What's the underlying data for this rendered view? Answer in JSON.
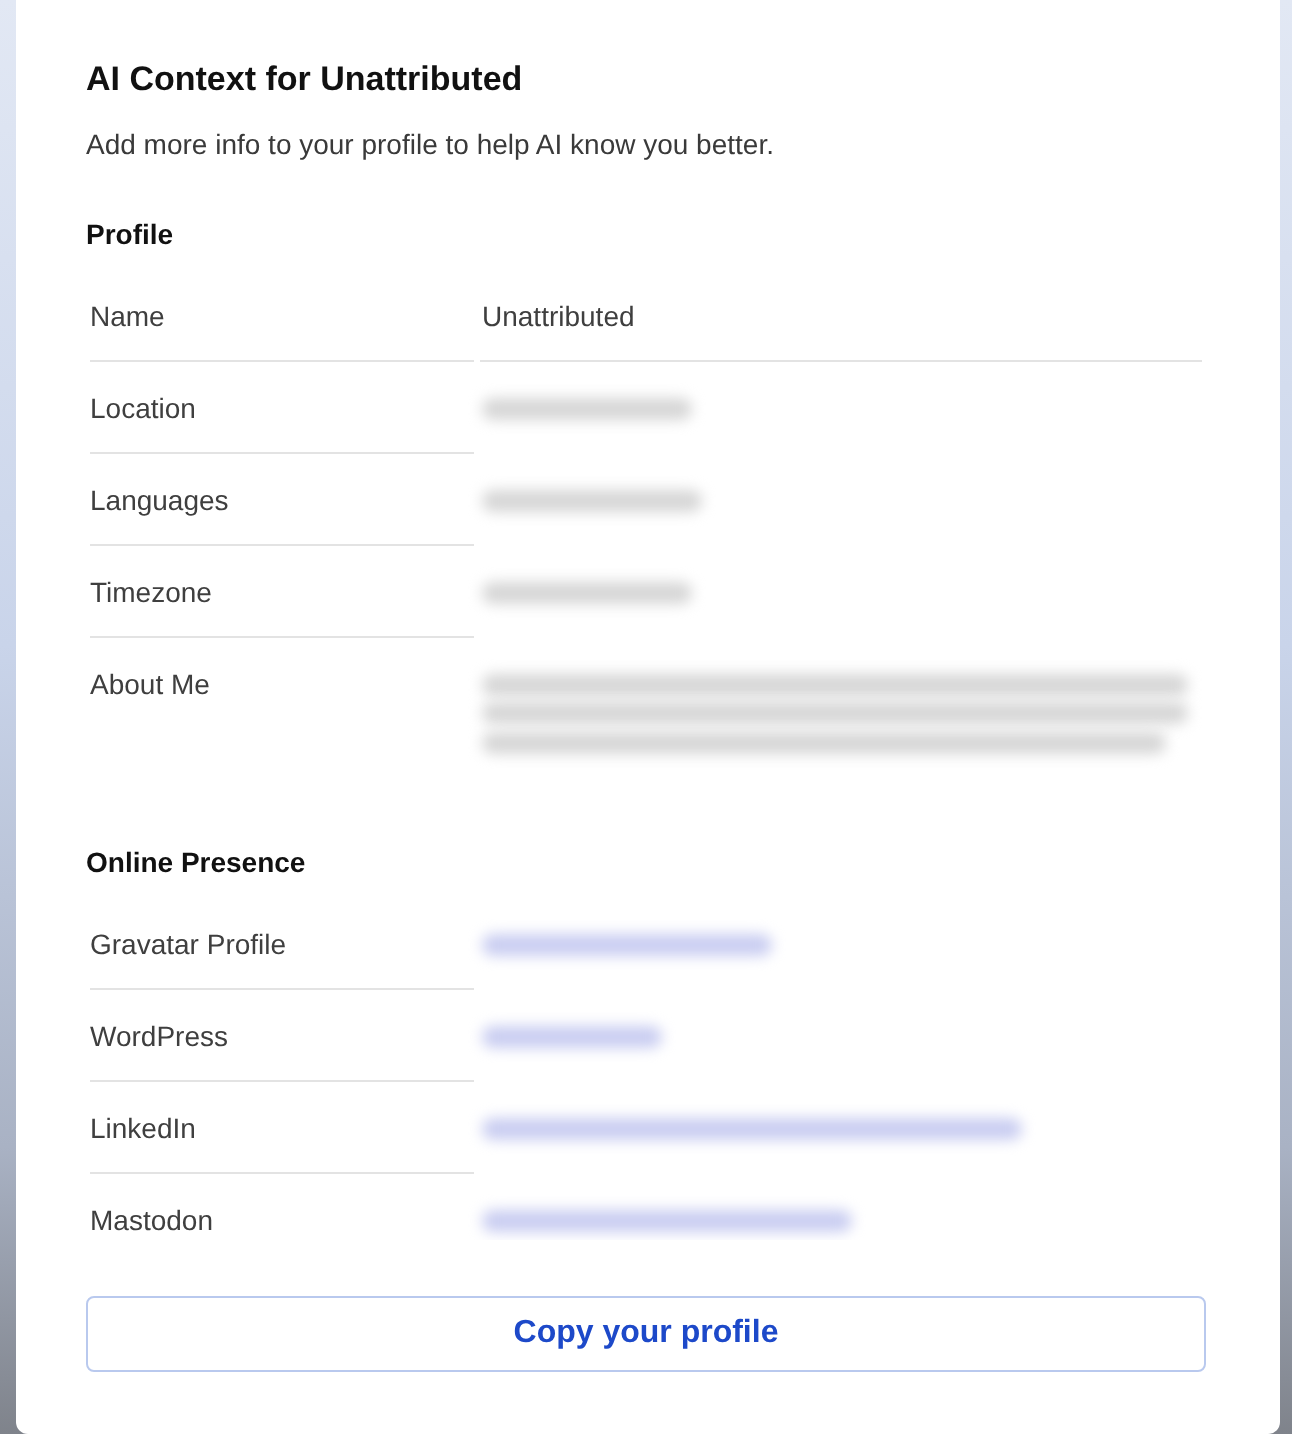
{
  "dialog": {
    "title": "AI Context for Unattributed",
    "subtitle": "Add more info to your profile to help AI know you better."
  },
  "sections": [
    {
      "heading": "Profile",
      "rows": [
        {
          "label": "Name",
          "kind": "text",
          "redacted": false,
          "value": "Unattributed"
        },
        {
          "label": "Location",
          "kind": "text",
          "redacted": true
        },
        {
          "label": "Languages",
          "kind": "text",
          "redacted": true
        },
        {
          "label": "Timezone",
          "kind": "text",
          "redacted": true
        },
        {
          "label": "About Me",
          "kind": "paragraph",
          "redacted": true
        }
      ]
    },
    {
      "heading": "Online Presence",
      "rows": [
        {
          "label": "Gravatar Profile",
          "kind": "link",
          "redacted": true
        },
        {
          "label": "WordPress",
          "kind": "link",
          "redacted": true
        },
        {
          "label": "LinkedIn",
          "kind": "link",
          "redacted": true
        },
        {
          "label": "Mastodon",
          "kind": "link",
          "redacted": true
        }
      ]
    }
  ],
  "footer": {
    "button": "Copy your profile"
  }
}
